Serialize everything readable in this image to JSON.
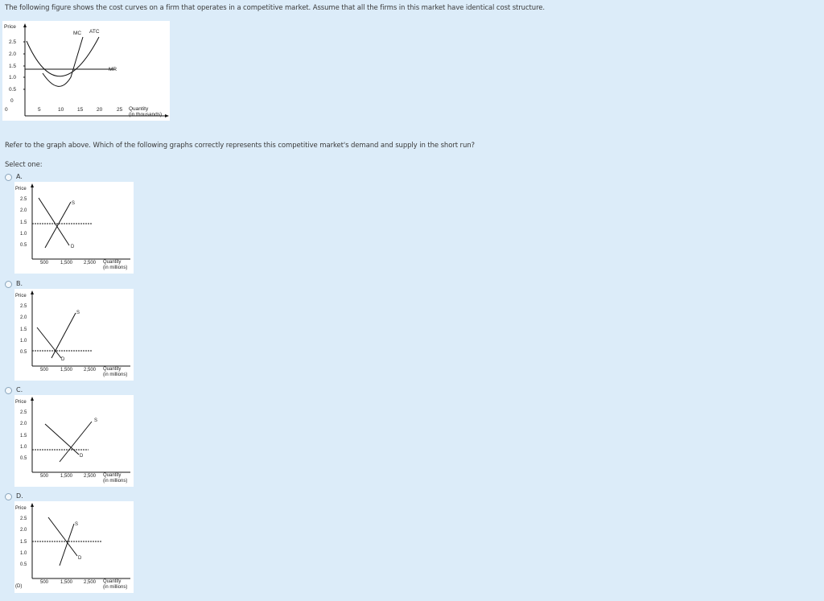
{
  "question": {
    "intro": "The following figure shows the cost curves on a firm that operates in a competitive market. Assume that all the firms in this market have identical cost structure.",
    "prompt": "Refer to the graph above. Which of the following graphs correctly represents this competitive market's demand and supply in the short run?",
    "select_label": "Select one:"
  },
  "firm_graph": {
    "y_axis_label": "Price",
    "y_ticks": [
      "2.5",
      "2.0",
      "1.5",
      "1.0",
      "0.5",
      "0"
    ],
    "x_ticks": [
      "0",
      "5",
      "10",
      "15",
      "20",
      "25"
    ],
    "x_axis_label": "Quantity",
    "x_axis_unit": "(in thousands)",
    "curve_labels": {
      "mc": "MC",
      "atc": "ATC",
      "mr": "MR"
    }
  },
  "market_graph_common": {
    "y_axis_label": "Price",
    "y_ticks": [
      "2.5",
      "2.0",
      "1.5",
      "1.0",
      "0.5"
    ],
    "x_ticks": [
      "500",
      "1,500",
      "2,500"
    ],
    "x_axis_label": "Quantity",
    "x_axis_unit": "(in millions)",
    "supply_label": "S",
    "demand_label": "D"
  },
  "options": [
    {
      "letter": "A.",
      "equilibrium_price": 1.5,
      "caption": ""
    },
    {
      "letter": "B.",
      "equilibrium_price": 0.5,
      "caption": ""
    },
    {
      "letter": "C.",
      "equilibrium_price": 0.75,
      "caption": ""
    },
    {
      "letter": "D.",
      "equilibrium_price": 1.5,
      "caption": "(D)"
    }
  ],
  "colors": {
    "page_bg": "#dcecf9",
    "figure_bg": "#ffffff",
    "line": "#111111",
    "radio_border": "#8aa6bd"
  }
}
